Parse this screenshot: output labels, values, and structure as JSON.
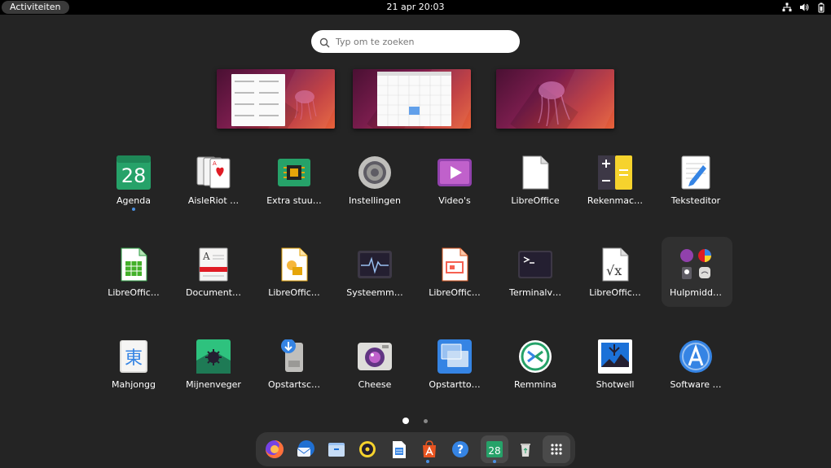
{
  "topbar": {
    "activities_label": "Activiteiten",
    "clock": "21 apr  20:03",
    "tray_icons": [
      "network-icon",
      "volume-icon",
      "battery-icon"
    ]
  },
  "search": {
    "placeholder": "Typ om te zoeken",
    "value": ""
  },
  "workspaces": [
    {
      "name": "workspace-1"
    },
    {
      "name": "workspace-2"
    },
    {
      "name": "workspace-3"
    }
  ],
  "apps": [
    {
      "label": "Agenda",
      "icon": "calendar-icon",
      "running": true
    },
    {
      "label": "AisleRiot …",
      "icon": "cards-icon"
    },
    {
      "label": "Extra stuu…",
      "icon": "chip-icon"
    },
    {
      "label": "Instellingen",
      "icon": "settings-icon"
    },
    {
      "label": "Video's",
      "icon": "video-icon"
    },
    {
      "label": "LibreOffice",
      "icon": "libreoffice-icon"
    },
    {
      "label": "Rekenmac…",
      "icon": "calculator-icon"
    },
    {
      "label": "Teksteditor",
      "icon": "text-editor-icon"
    },
    {
      "label": "LibreOffic…",
      "icon": "calc-icon"
    },
    {
      "label": "Document…",
      "icon": "document-viewer-icon"
    },
    {
      "label": "LibreOffic…",
      "icon": "draw-icon"
    },
    {
      "label": "Systeemm…",
      "icon": "system-monitor-icon"
    },
    {
      "label": "LibreOffic…",
      "icon": "impress-icon"
    },
    {
      "label": "Terminalv…",
      "icon": "terminal-icon"
    },
    {
      "label": "LibreOffic…",
      "icon": "math-icon"
    },
    {
      "label": "Hulpmidd…",
      "icon": "utilities-folder-icon"
    },
    {
      "label": "Mahjongg",
      "icon": "mahjongg-icon"
    },
    {
      "label": "Mijnenveger",
      "icon": "mines-icon"
    },
    {
      "label": "Opstartsc…",
      "icon": "usb-creator-icon"
    },
    {
      "label": "Cheese",
      "icon": "cheese-icon"
    },
    {
      "label": "Opstartto…",
      "icon": "startup-apps-icon"
    },
    {
      "label": "Remmina",
      "icon": "remmina-icon"
    },
    {
      "label": "Shotwell",
      "icon": "shotwell-icon"
    },
    {
      "label": "Software …",
      "icon": "software-icon"
    }
  ],
  "pagination": {
    "pages": 2,
    "current": 1
  },
  "dock": {
    "items": [
      "firefox-icon",
      "thunderbird-icon",
      "files-icon",
      "rhythmbox-icon",
      "writer-icon",
      "software-store-icon",
      "help-icon",
      "calendar-icon",
      "trash-icon",
      "show-apps-icon"
    ],
    "calendar_day": "28",
    "running": [
      "software-store-icon",
      "calendar-icon"
    ]
  },
  "colors": {
    "background": "#242424",
    "topbar": "#000000",
    "accent": "#4a90e2",
    "wallpaper": "#7a1d4d"
  }
}
